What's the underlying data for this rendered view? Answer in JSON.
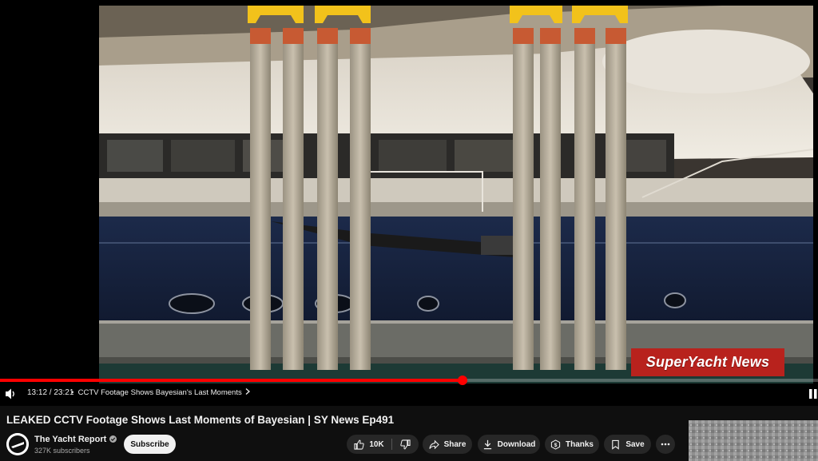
{
  "player": {
    "watermark": "SuperYacht News",
    "current_time": "13:12",
    "duration": "23:21",
    "time_separator": " / ",
    "chapter_bullet": "•",
    "chapter_title": "CCTV Footage Shows Bayesian's Last Moments",
    "progress_fraction": 0.5651,
    "icons": {
      "volume": "volume-icon",
      "chapter_chevron": "chevron-right-icon",
      "pause": "pause-icon"
    },
    "colors": {
      "progress": "#ff0000",
      "watermark_bg": "#b8221d"
    }
  },
  "video": {
    "title": "LEAKED CCTV Footage Shows Last Moments of Bayesian | SY News Ep491"
  },
  "channel": {
    "name": "The Yacht Report",
    "subscribers": "327K subscribers",
    "subscribe_label": "Subscribe",
    "verified_icon": "verified-check-icon"
  },
  "actions": {
    "like_count": "10K",
    "share_label": "Share",
    "download_label": "Download",
    "thanks_label": "Thanks",
    "save_label": "Save",
    "icons": {
      "like": "thumbs-up-icon",
      "dislike": "thumbs-down-icon",
      "share": "share-arrow-icon",
      "download": "download-icon",
      "thanks": "thanks-dollar-icon",
      "save": "bookmark-icon",
      "more": "more-horizontal-icon"
    }
  }
}
